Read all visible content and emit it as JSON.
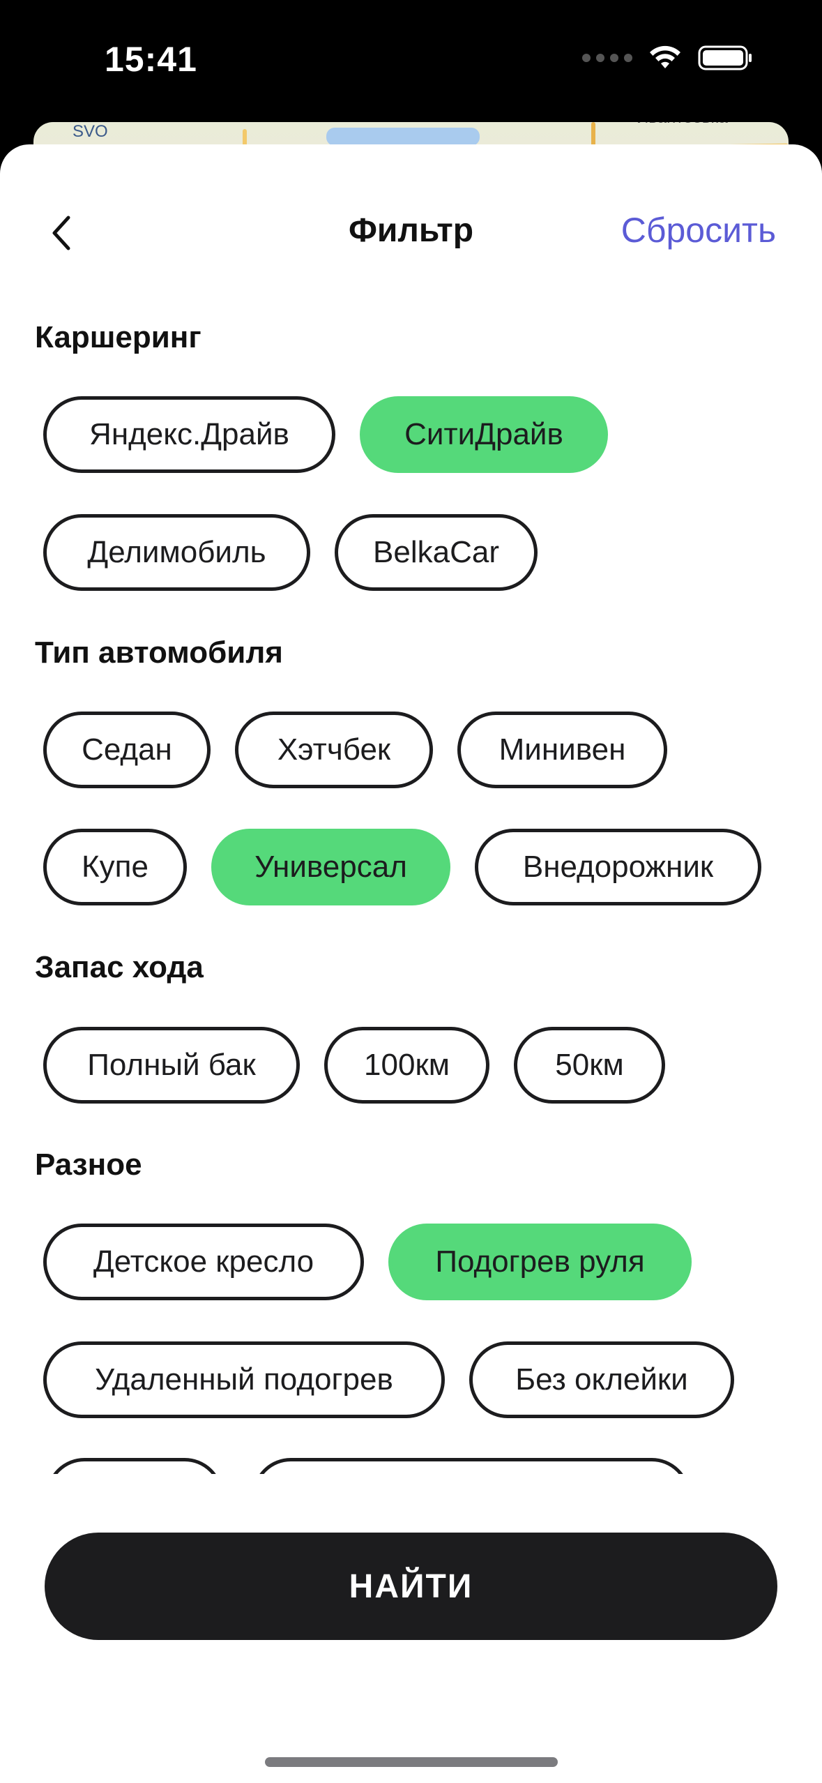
{
  "status_bar": {
    "time": "15:41",
    "icons": [
      "signal-dots-icon",
      "wifi-icon",
      "battery-icon"
    ]
  },
  "map": {
    "labels": [
      "SVO",
      "Ивантеевка"
    ]
  },
  "nav": {
    "title": "Фильтр",
    "reset_label": "Сбросить",
    "back_icon": "chevron-left-icon"
  },
  "sections": {
    "carsharing": {
      "title": "Каршеринг",
      "options": [
        {
          "label": "Яндекс.Драйв",
          "selected": false
        },
        {
          "label": "СитиДрайв",
          "selected": true
        },
        {
          "label": "Делимобиль",
          "selected": false
        },
        {
          "label": "BelkaCar",
          "selected": false
        }
      ]
    },
    "car_type": {
      "title": "Тип автомобиля",
      "options": [
        {
          "label": "Седан",
          "selected": false
        },
        {
          "label": "Хэтчбек",
          "selected": false
        },
        {
          "label": "Минивен",
          "selected": false
        },
        {
          "label": "Купе",
          "selected": false
        },
        {
          "label": "Универсал",
          "selected": true
        },
        {
          "label": "Внедорожник",
          "selected": false
        }
      ]
    },
    "range": {
      "title": "Запас хода",
      "options": [
        {
          "label": "Полный бак",
          "selected": false
        },
        {
          "label": "100км",
          "selected": false
        },
        {
          "label": "50км",
          "selected": false
        }
      ]
    },
    "misc": {
      "title": "Разное",
      "options": [
        {
          "label": "Детское кресло",
          "selected": false
        },
        {
          "label": "Подогрев руля",
          "selected": true
        },
        {
          "label": "Удаленный подогрев",
          "selected": false
        },
        {
          "label": "Без оклейки",
          "selected": false
        }
      ]
    }
  },
  "find_button_label": "НАЙТИ",
  "colors": {
    "accent_selected": "#55d97a",
    "link": "#5b5bd6",
    "dark": "#1c1c1e"
  }
}
